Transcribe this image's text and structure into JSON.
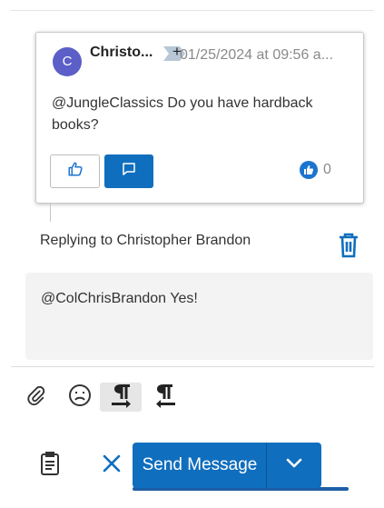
{
  "message": {
    "avatar_initial": "C",
    "author": "Christo...",
    "timestamp": "01/25/2024 at 09:56 a...",
    "body": "@JungleClassics Do you have hardback books?",
    "reaction_count": "0"
  },
  "reply": {
    "replying_to": "Replying to Christopher Brandon",
    "compose_text": "@ColChrisBrandon Yes!"
  },
  "actions": {
    "send_label": "Send Message"
  },
  "icons": {
    "pin": "pin-plus-icon",
    "like": "thumbs-up-icon",
    "reply": "chat-bubble-icon",
    "reaction": "thumbs-up-reaction-icon",
    "delete": "trash-icon",
    "attach": "paperclip-icon",
    "emoji": "emoji-icon",
    "ltr": "paragraph-ltr-icon",
    "rtl": "paragraph-rtl-icon",
    "clipboard": "clipboard-icon",
    "cancel": "close-icon",
    "dropdown": "chevron-down-icon"
  },
  "colors": {
    "primary": "#106ebe",
    "avatar": "#5b5fc7",
    "compose_bg": "#f3f3f3"
  }
}
